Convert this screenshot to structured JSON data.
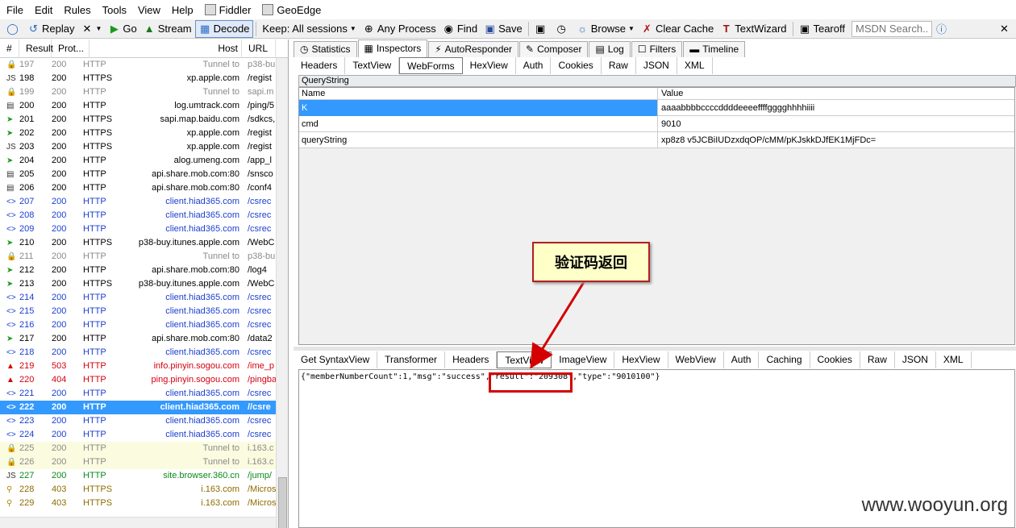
{
  "menu": [
    {
      "label": "File"
    },
    {
      "label": "Edit"
    },
    {
      "label": "Rules"
    },
    {
      "label": "Tools"
    },
    {
      "label": "View"
    },
    {
      "label": "Help"
    },
    {
      "label": "Fiddler",
      "icon": "fiddler-icon"
    },
    {
      "label": "GeoEdge",
      "icon": "geoedge-icon"
    }
  ],
  "toolbar": {
    "replay": "Replay",
    "go": "Go",
    "stream": "Stream",
    "decode": "Decode",
    "keep": "Keep: All sessions",
    "any_process": "Any Process",
    "find": "Find",
    "save": "Save",
    "browse": "Browse",
    "clear_cache": "Clear Cache",
    "text_wizard": "TextWizard",
    "tearoff": "Tearoff",
    "msdn_placeholder": "MSDN Search..."
  },
  "sessions": {
    "headers": {
      "num": "#",
      "result": "Result",
      "protocol": "Prot...",
      "host": "Host",
      "url": "URL"
    },
    "rows": [
      {
        "num": "197",
        "result": "200",
        "protocol": "HTTP",
        "host": "Tunnel to",
        "url": "p38-bu",
        "style": "gray",
        "icon": "lock-icon"
      },
      {
        "num": "198",
        "result": "200",
        "protocol": "HTTPS",
        "host": "xp.apple.com",
        "url": "/regist",
        "style": "",
        "icon": "js-icon"
      },
      {
        "num": "199",
        "result": "200",
        "protocol": "HTTP",
        "host": "Tunnel to",
        "url": "sapi.m",
        "style": "gray",
        "icon": "lock-icon"
      },
      {
        "num": "200",
        "result": "200",
        "protocol": "HTTP",
        "host": "log.umtrack.com",
        "url": "/ping/5",
        "style": "",
        "icon": "doc-icon"
      },
      {
        "num": "201",
        "result": "200",
        "protocol": "HTTPS",
        "host": "sapi.map.baidu.com",
        "url": "/sdkcs,",
        "style": "",
        "icon": "arrow-right-icon"
      },
      {
        "num": "202",
        "result": "200",
        "protocol": "HTTPS",
        "host": "xp.apple.com",
        "url": "/regist",
        "style": "",
        "icon": "arrow-right-icon"
      },
      {
        "num": "203",
        "result": "200",
        "protocol": "HTTPS",
        "host": "xp.apple.com",
        "url": "/regist",
        "style": "",
        "icon": "js-icon"
      },
      {
        "num": "204",
        "result": "200",
        "protocol": "HTTP",
        "host": "alog.umeng.com",
        "url": "/app_l",
        "style": "",
        "icon": "arrow-right-icon"
      },
      {
        "num": "205",
        "result": "200",
        "protocol": "HTTP",
        "host": "api.share.mob.com:80",
        "url": "/snsco",
        "style": "",
        "icon": "doc-icon"
      },
      {
        "num": "206",
        "result": "200",
        "protocol": "HTTP",
        "host": "api.share.mob.com:80",
        "url": "/conf4",
        "style": "",
        "icon": "doc-icon"
      },
      {
        "num": "207",
        "result": "200",
        "protocol": "HTTP",
        "host": "client.hiad365.com",
        "url": "/csrec",
        "style": "blue",
        "icon": "code-icon"
      },
      {
        "num": "208",
        "result": "200",
        "protocol": "HTTP",
        "host": "client.hiad365.com",
        "url": "/csrec",
        "style": "blue",
        "icon": "code-icon"
      },
      {
        "num": "209",
        "result": "200",
        "protocol": "HTTP",
        "host": "client.hiad365.com",
        "url": "/csrec",
        "style": "blue",
        "icon": "code-icon"
      },
      {
        "num": "210",
        "result": "200",
        "protocol": "HTTPS",
        "host": "p38-buy.itunes.apple.com",
        "url": "/WebC",
        "style": "",
        "icon": "arrow-right-icon"
      },
      {
        "num": "211",
        "result": "200",
        "protocol": "HTTP",
        "host": "Tunnel to",
        "url": "p38-bu",
        "style": "gray",
        "icon": "lock-icon"
      },
      {
        "num": "212",
        "result": "200",
        "protocol": "HTTP",
        "host": "api.share.mob.com:80",
        "url": "/log4",
        "style": "",
        "icon": "arrow-right-icon"
      },
      {
        "num": "213",
        "result": "200",
        "protocol": "HTTPS",
        "host": "p38-buy.itunes.apple.com",
        "url": "/WebC",
        "style": "",
        "icon": "arrow-right-icon"
      },
      {
        "num": "214",
        "result": "200",
        "protocol": "HTTP",
        "host": "client.hiad365.com",
        "url": "/csrec",
        "style": "blue",
        "icon": "code-icon"
      },
      {
        "num": "215",
        "result": "200",
        "protocol": "HTTP",
        "host": "client.hiad365.com",
        "url": "/csrec",
        "style": "blue",
        "icon": "code-icon"
      },
      {
        "num": "216",
        "result": "200",
        "protocol": "HTTP",
        "host": "client.hiad365.com",
        "url": "/csrec",
        "style": "blue",
        "icon": "code-icon"
      },
      {
        "num": "217",
        "result": "200",
        "protocol": "HTTP",
        "host": "api.share.mob.com:80",
        "url": "/data2",
        "style": "",
        "icon": "arrow-right-icon"
      },
      {
        "num": "218",
        "result": "200",
        "protocol": "HTTP",
        "host": "client.hiad365.com",
        "url": "/csrec",
        "style": "blue",
        "icon": "code-icon"
      },
      {
        "num": "219",
        "result": "503",
        "protocol": "HTTP",
        "host": "info.pinyin.sogou.com",
        "url": "/ime_p",
        "style": "red",
        "icon": "warning-icon"
      },
      {
        "num": "220",
        "result": "404",
        "protocol": "HTTP",
        "host": "ping.pinyin.sogou.com",
        "url": "/pingba",
        "style": "red",
        "icon": "warning-icon"
      },
      {
        "num": "221",
        "result": "200",
        "protocol": "HTTP",
        "host": "client.hiad365.com",
        "url": "/csrec",
        "style": "blue",
        "icon": "code-icon"
      },
      {
        "num": "222",
        "result": "200",
        "protocol": "HTTP",
        "host": "client.hiad365.com",
        "url": "//csre",
        "style": "selected",
        "icon": "code-icon"
      },
      {
        "num": "223",
        "result": "200",
        "protocol": "HTTP",
        "host": "client.hiad365.com",
        "url": "/csrec",
        "style": "blue",
        "icon": "code-icon"
      },
      {
        "num": "224",
        "result": "200",
        "protocol": "HTTP",
        "host": "client.hiad365.com",
        "url": "/csrec",
        "style": "blue",
        "icon": "code-icon"
      },
      {
        "num": "225",
        "result": "200",
        "protocol": "HTTP",
        "host": "Tunnel to",
        "url": "i.163.c",
        "style": "gray yellow",
        "icon": "lock-icon"
      },
      {
        "num": "226",
        "result": "200",
        "protocol": "HTTP",
        "host": "Tunnel to",
        "url": "i.163.c",
        "style": "gray yellow",
        "icon": "lock-icon"
      },
      {
        "num": "227",
        "result": "200",
        "protocol": "HTTP",
        "host": "site.browser.360.cn",
        "url": "/jump/",
        "style": "green",
        "icon": "js-icon"
      },
      {
        "num": "228",
        "result": "403",
        "protocol": "HTTPS",
        "host": "i.163.com",
        "url": "/Micros",
        "style": "olive",
        "icon": "key-icon"
      },
      {
        "num": "229",
        "result": "403",
        "protocol": "HTTPS",
        "host": "i.163.com",
        "url": "/Micros",
        "style": "olive",
        "icon": "key-icon"
      }
    ]
  },
  "inspector": {
    "top_tabs": [
      {
        "label": "Statistics",
        "icon": "clock-icon"
      },
      {
        "label": "Inspectors",
        "icon": "inspect-icon",
        "active": true
      },
      {
        "label": "AutoResponder",
        "icon": "lightning-icon"
      },
      {
        "label": "Composer",
        "icon": "compose-icon"
      },
      {
        "label": "Log",
        "icon": "log-icon"
      },
      {
        "label": "Filters",
        "icon": "checkbox-icon"
      },
      {
        "label": "Timeline",
        "icon": "timeline-icon"
      }
    ],
    "request_tabs": [
      "Headers",
      "TextView",
      "WebForms",
      "HexView",
      "Auth",
      "Cookies",
      "Raw",
      "JSON",
      "XML"
    ],
    "request_active": "WebForms",
    "querystring_title": "QueryString",
    "grid_headers": {
      "name": "Name",
      "value": "Value"
    },
    "grid_rows": [
      {
        "name": "K",
        "value": "aaaabbbbccccddddeeeeffffgggghhhhiiii"
      },
      {
        "name": "cmd",
        "value": "9010"
      },
      {
        "name": "queryString",
        "value": "xp8z8 v5JCBiIUDzxdqOP/cMM/pKJskkDJfEK1MjFDc="
      }
    ],
    "response_tabs": [
      "Get SyntaxView",
      "Transformer",
      "Headers",
      "TextView",
      "ImageView",
      "HexView",
      "WebView",
      "Auth",
      "Caching",
      "Cookies",
      "Raw",
      "JSON",
      "XML"
    ],
    "response_active": "TextView",
    "response_body": "{\"memberNumberCount\":1,\"msg\":\"success\",\"result\":\"209308\",\"type\":\"9010100\"}"
  },
  "annotation": {
    "callout_text": "验证码返回"
  },
  "watermark": "www.wooyun.org"
}
